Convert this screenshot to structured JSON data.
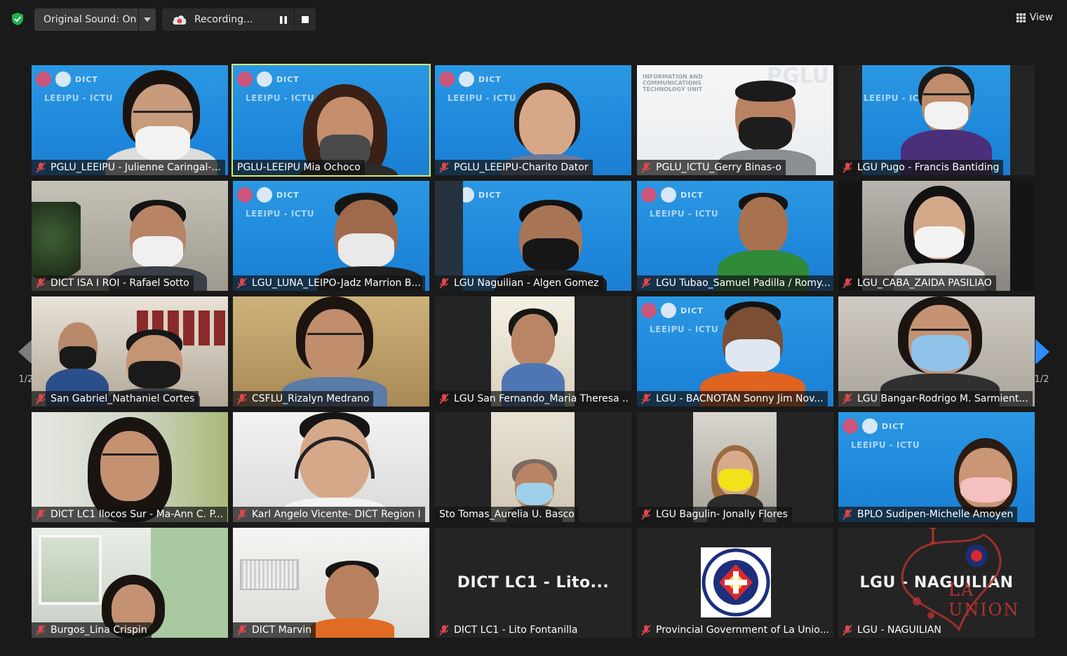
{
  "toolbar": {
    "original_sound_label": "Original Sound: On",
    "recording_label": "Recording...",
    "view_label": "View"
  },
  "pagination": {
    "left_page": "1/2",
    "right_page": "1/2"
  },
  "tiles": [
    {
      "name": "PGLU_LEEIPU - Julienne Caringal-...",
      "muted": true
    },
    {
      "name": "PGLU-LEEIPU Mia Ochoco",
      "muted": false
    },
    {
      "name": "PGLU_LEEIPU-Charito Dator",
      "muted": true
    },
    {
      "name": "PGLU_ICTU_Gerry Binas-o",
      "muted": true
    },
    {
      "name": "LGU Pugo - Francis Bantiding",
      "muted": true
    },
    {
      "name": "DICT ISA I ROI - Rafael Sotto",
      "muted": true
    },
    {
      "name": "LGU_LUNA_LEIPO-Jadz Marrion B...",
      "muted": true
    },
    {
      "name": "LGU Naguilian - Algen Gomez",
      "muted": true
    },
    {
      "name": "LGU Tubao_Samuel Padilla / Romy...",
      "muted": true
    },
    {
      "name": "LGU_CABA_ZAIDA PASILIAO",
      "muted": true
    },
    {
      "name": "San Gabriel_Nathaniel Cortes",
      "muted": true
    },
    {
      "name": "CSFLU_Rizalyn Medrano",
      "muted": true
    },
    {
      "name": "LGU San Fernando_Maria Theresa ...",
      "muted": true
    },
    {
      "name": "LGU - BACNOTAN Sonny Jim Nov...",
      "muted": true
    },
    {
      "name": "LGU Bangar-Rodrigo M. Sarmient...",
      "muted": true
    },
    {
      "name": "DICT LC1 Ilocos Sur - Ma-Ann C. P...",
      "muted": true
    },
    {
      "name": "Karl Angelo Vicente- DICT Region I",
      "muted": true
    },
    {
      "name": "Sto Tomas_Aurelia U. Basco",
      "muted": false
    },
    {
      "name": "LGU Bagulin- Jonally Flores",
      "muted": true
    },
    {
      "name": "BPLO Sudipen-Michelle Amoyen",
      "muted": true
    },
    {
      "name": "Burgos_Lina Crispin",
      "muted": true
    },
    {
      "name": "DICT Marvin",
      "muted": true
    },
    {
      "name": "DICT LC1 - Lito Fontanilla",
      "muted": true
    },
    {
      "name": "Provincial Government of La Unio...",
      "muted": true
    },
    {
      "name": "LGU - NAGUILIAN",
      "muted": true
    }
  ],
  "tile_overlays": {
    "lito_display": "DICT LC1 - Lito...",
    "naguilian_display": "LGU - NAGUILIAN",
    "leeipu_text": "LEEIPU - ICTU",
    "dict_text": "DICT",
    "ictu_banner": "INFORMATION AND COMMUNICATIONS TECHNOLOGY UNIT",
    "pglu_text": "PGLU",
    "seal_text": "PROVINCE OF LA UNION · OFFICIAL SEAL · 1850"
  },
  "watermark": {
    "line1": "I",
    "line2": "LA UNION"
  },
  "colors": {
    "active_speaker": "#d8e86b",
    "muted_mic": "#e0474c",
    "shield": "#23b14d",
    "nav_arrow_right": "#2d8cff",
    "nav_arrow_left": "#7d7d7d"
  }
}
